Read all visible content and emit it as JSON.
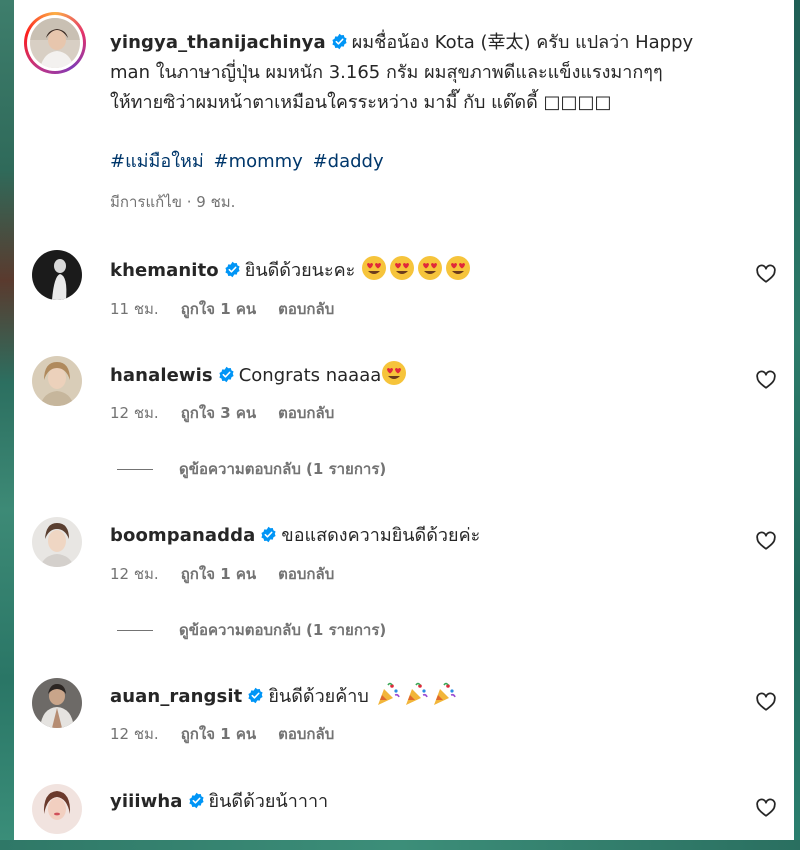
{
  "post": {
    "username": "yingya_thanijachinya",
    "caption_line1": "ผมชื่อน้อง Kota (幸太) ครับ แปลว่า Happy",
    "caption_line2": "man ในภาษาญี่ปุ่น ผมหนัก 3.165 กรัม ผมสุขภาพดีและแข็งแรงมากๆๆ",
    "caption_line3": "ให้ทายซิว่าผมหน้าตาเหมือนใครระหว่าง มามี๊ กับ แด๊ดดี้ □□□□",
    "hashtags": [
      "#แม่มือใหม่",
      "#mommy",
      "#daddy"
    ],
    "edited_text": "มีการแก้ไข · 9 ชม."
  },
  "comments": [
    {
      "username": "khemanito",
      "text": "ยินดีด้วยนะคะ",
      "emoji": [
        "heart-eyes",
        "heart-eyes",
        "heart-eyes",
        "heart-eyes"
      ],
      "time": "11 ชม.",
      "likes": "ถูกใจ 1 คน",
      "reply": "ตอบกลับ"
    },
    {
      "username": "hanalewis",
      "text": "Congrats naaaa",
      "emoji": [
        "heart-eyes"
      ],
      "time": "12 ชม.",
      "likes": "ถูกใจ 3 คน",
      "reply": "ตอบกลับ",
      "view_replies": "ดูข้อความตอบกลับ (1 รายการ)"
    },
    {
      "username": "boompanadda",
      "text": "ขอแสดงความยินดีด้วยค่ะ",
      "emoji": [],
      "time": "12 ชม.",
      "likes": "ถูกใจ 1 คน",
      "reply": "ตอบกลับ",
      "view_replies": "ดูข้อความตอบกลับ (1 รายการ)"
    },
    {
      "username": "auan_rangsit",
      "text": "ยินดีด้วยค้าบ",
      "emoji": [
        "party-popper",
        "party-popper",
        "party-popper"
      ],
      "time": "12 ชม.",
      "likes": "ถูกใจ 1 คน",
      "reply": "ตอบกลับ"
    },
    {
      "username": "yiiiwha",
      "text": "ยินดีด้วยน้าาาา",
      "emoji": []
    }
  ],
  "icons": {
    "verified": "verified-badge-icon",
    "like": "heart-outline-icon"
  },
  "colors": {
    "verified": "#0095f6",
    "text": "#262626",
    "secondary": "#737373",
    "hashtag": "#00376b"
  }
}
